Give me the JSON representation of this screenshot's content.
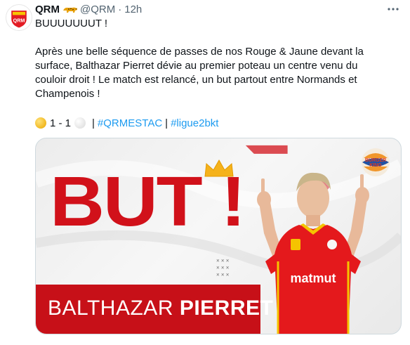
{
  "author": {
    "display_name": "QRM",
    "handle": "@QRM",
    "separator": "·",
    "time": "12h"
  },
  "icons": {
    "avatar": "qrm-crest-icon",
    "mascot": "jaguar-emoji-icon",
    "more": "more-dots-icon",
    "home_team": "yellow-circle-icon",
    "away_team": "white-circle-icon",
    "sponsor": "burger-king-logo-icon",
    "crown": "crown-icon"
  },
  "tweet": {
    "line1": "BUUUUUUUT !",
    "p2_line1": "Après une belle séquence de passes de nos Rouge & Jaune devant la",
    "p2_line2": "surface, Balthazar Pierret dévie au premier poteau un centre venu du",
    "p2_line3": "couloir droit ! Le match est relancé, un but partout entre Normands et",
    "p2_line4": "Champenois !",
    "score": "1 - 1",
    "pipe1": "|",
    "hashtag1": "#QRMESTAC",
    "pipe2": "|",
    "hashtag2": "#ligue2bkt"
  },
  "media": {
    "headline": "BUT",
    "exclamation": "!",
    "first_name": "BALTHAZAR",
    "last_name": "PIERRET",
    "sponsor_line1": "BURGER",
    "sponsor_line2": "KING",
    "jersey_sponsor": "matmut",
    "crest_text": "QRM"
  },
  "colors": {
    "brand_red": "#c71018",
    "headline_red": "#d1111a",
    "link_blue": "#1d9bf0",
    "secondary_text": "#536471",
    "crown_yellow": "#f5b21b"
  }
}
